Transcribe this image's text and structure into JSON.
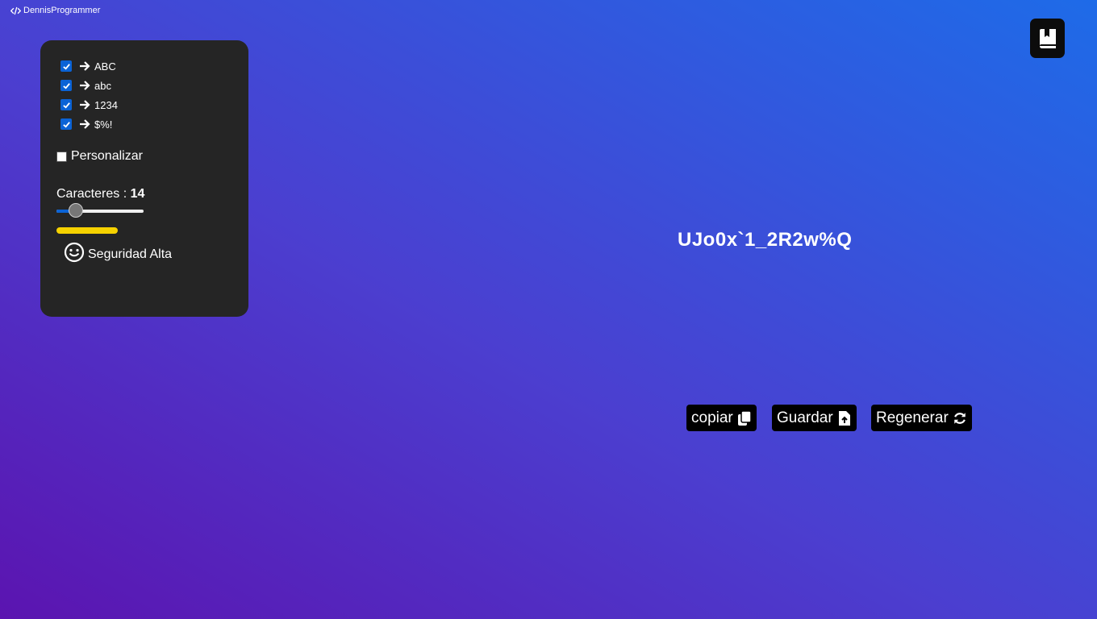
{
  "brand": {
    "text": "DennisProgrammer",
    "icon": "code-icon"
  },
  "options": [
    {
      "label": "ABC",
      "checked": true
    },
    {
      "label": "abc",
      "checked": true
    },
    {
      "label": "1234",
      "checked": true
    },
    {
      "label": "$%!",
      "checked": true
    }
  ],
  "custom": {
    "label": "Personalizar",
    "checked": false
  },
  "length": {
    "label": "Caracteres : ",
    "value": "14",
    "slider_fraction": 0.14
  },
  "strength": {
    "label": "Seguridad Alta",
    "color": "#f6d200",
    "icon": "smile-icon"
  },
  "password": "UJo0x`1_2R2w%Q",
  "buttons": {
    "copy": "copiar",
    "save": "Guardar",
    "regenerate": "Regenerar"
  },
  "colors": {
    "accent": "#0b63d6",
    "panel": "#252525",
    "button": "#000000"
  }
}
